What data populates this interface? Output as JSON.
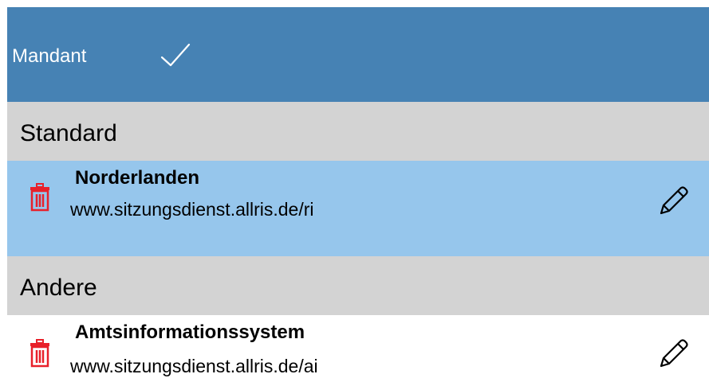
{
  "header": {
    "title": "Mandant",
    "confirm_icon": "checkmark-icon",
    "background_color": "#4682b4"
  },
  "sections": [
    {
      "label": "Standard",
      "entries": [
        {
          "name": "Norderlanden",
          "url": "www.sitzungsdienst.allris.de/ri",
          "selected": true,
          "delete_icon": "trash-icon",
          "edit_icon": "pencil-icon"
        }
      ]
    },
    {
      "label": "Andere",
      "entries": [
        {
          "name": "Amtsinformationssystem",
          "url": "www.sitzungsdienst.allris.de/ai",
          "selected": false,
          "delete_icon": "trash-icon",
          "edit_icon": "pencil-icon"
        }
      ]
    }
  ],
  "colors": {
    "section_background": "#d3d3d3",
    "selected_row_background": "#96c6ec",
    "delete_icon_color": "#e8202a"
  }
}
